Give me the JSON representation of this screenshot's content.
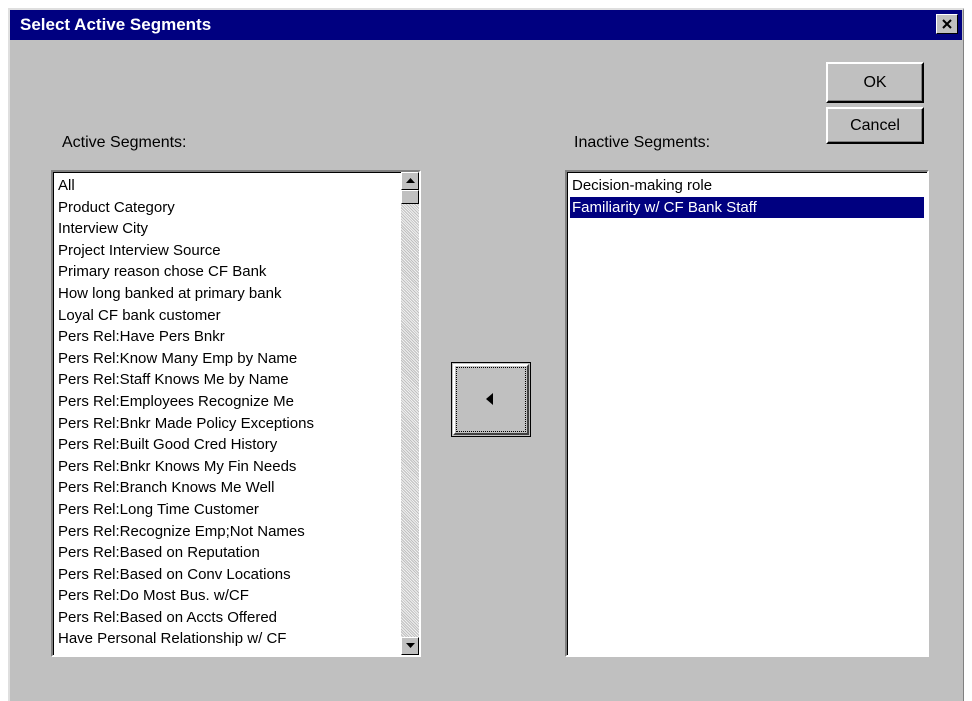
{
  "dialog": {
    "title": "Select Active Segments",
    "close_icon": "close-x-icon"
  },
  "buttons": {
    "ok_label": "OK",
    "cancel_label": "Cancel",
    "move_icon": "left-arrow-icon"
  },
  "active": {
    "label": "Active Segments:",
    "items": [
      "All",
      "Product Category",
      "Interview City",
      "Project Interview Source",
      "Primary reason chose CF Bank",
      "How long banked at primary bank",
      "Loyal CF bank customer",
      "Pers Rel:Have Pers Bnkr",
      "Pers Rel:Know Many Emp by Name",
      "Pers Rel:Staff Knows Me by Name",
      "Pers Rel:Employees Recognize Me",
      "Pers Rel:Bnkr Made Policy Exceptions",
      "Pers Rel:Built Good Cred History",
      "Pers Rel:Bnkr Knows My Fin Needs",
      "Pers Rel:Branch Knows Me Well",
      "Pers Rel:Long Time Customer",
      "Pers Rel:Recognize Emp;Not Names",
      "Pers Rel:Based on Reputation",
      "Pers Rel:Based on Conv Locations",
      "Pers Rel:Do Most Bus. w/CF",
      "Pers Rel:Based on Accts Offered",
      "Have Personal Relationship w/ CF"
    ]
  },
  "inactive": {
    "label": "Inactive Segments:",
    "items": [
      "Decision-making role",
      "Familiarity w/ CF Bank Staff"
    ],
    "selected_index": 1
  },
  "colors": {
    "titlebar": "#000080",
    "dialog_bg": "#c0c0c0",
    "selection": "#000080"
  }
}
